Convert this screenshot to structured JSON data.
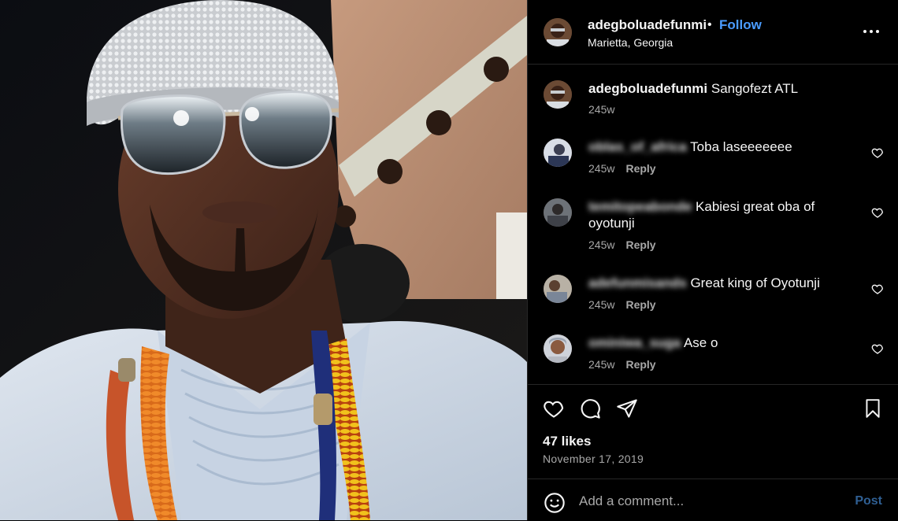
{
  "header": {
    "username": "adegboluadefunmi",
    "separator": "•",
    "follow_label": "Follow",
    "location": "Marietta, Georgia",
    "more_icon": "more-horizontal-icon"
  },
  "caption": {
    "username": "adegboluadefunmi",
    "text": "Sangofezt ATL",
    "time": "245w"
  },
  "comments": [
    {
      "username": "oblas_of_africa",
      "text": "Toba laseeeeeee",
      "time": "245w",
      "reply_label": "Reply"
    },
    {
      "username": "temitopeabonde",
      "text": "Kabiesi great oba of oyotunji",
      "time": "245w",
      "reply_label": "Reply"
    },
    {
      "username": "adefunmisands",
      "text": "Great king of Oyotunji",
      "time": "245w",
      "reply_label": "Reply"
    },
    {
      "username": "ominiwa_suga",
      "text": "Ase o",
      "time": "245w",
      "reply_label": "Reply"
    }
  ],
  "actions": {
    "icons": [
      "heart-icon",
      "comment-icon",
      "share-icon",
      "bookmark-icon"
    ],
    "likes": "47 likes",
    "date": "November 17, 2019"
  },
  "add_comment": {
    "placeholder": "Add a comment...",
    "post_label": "Post"
  },
  "colors": {
    "background": "#000000",
    "accent": "#4a9cff",
    "muted": "#a8a8a8",
    "divider": "#262626"
  }
}
